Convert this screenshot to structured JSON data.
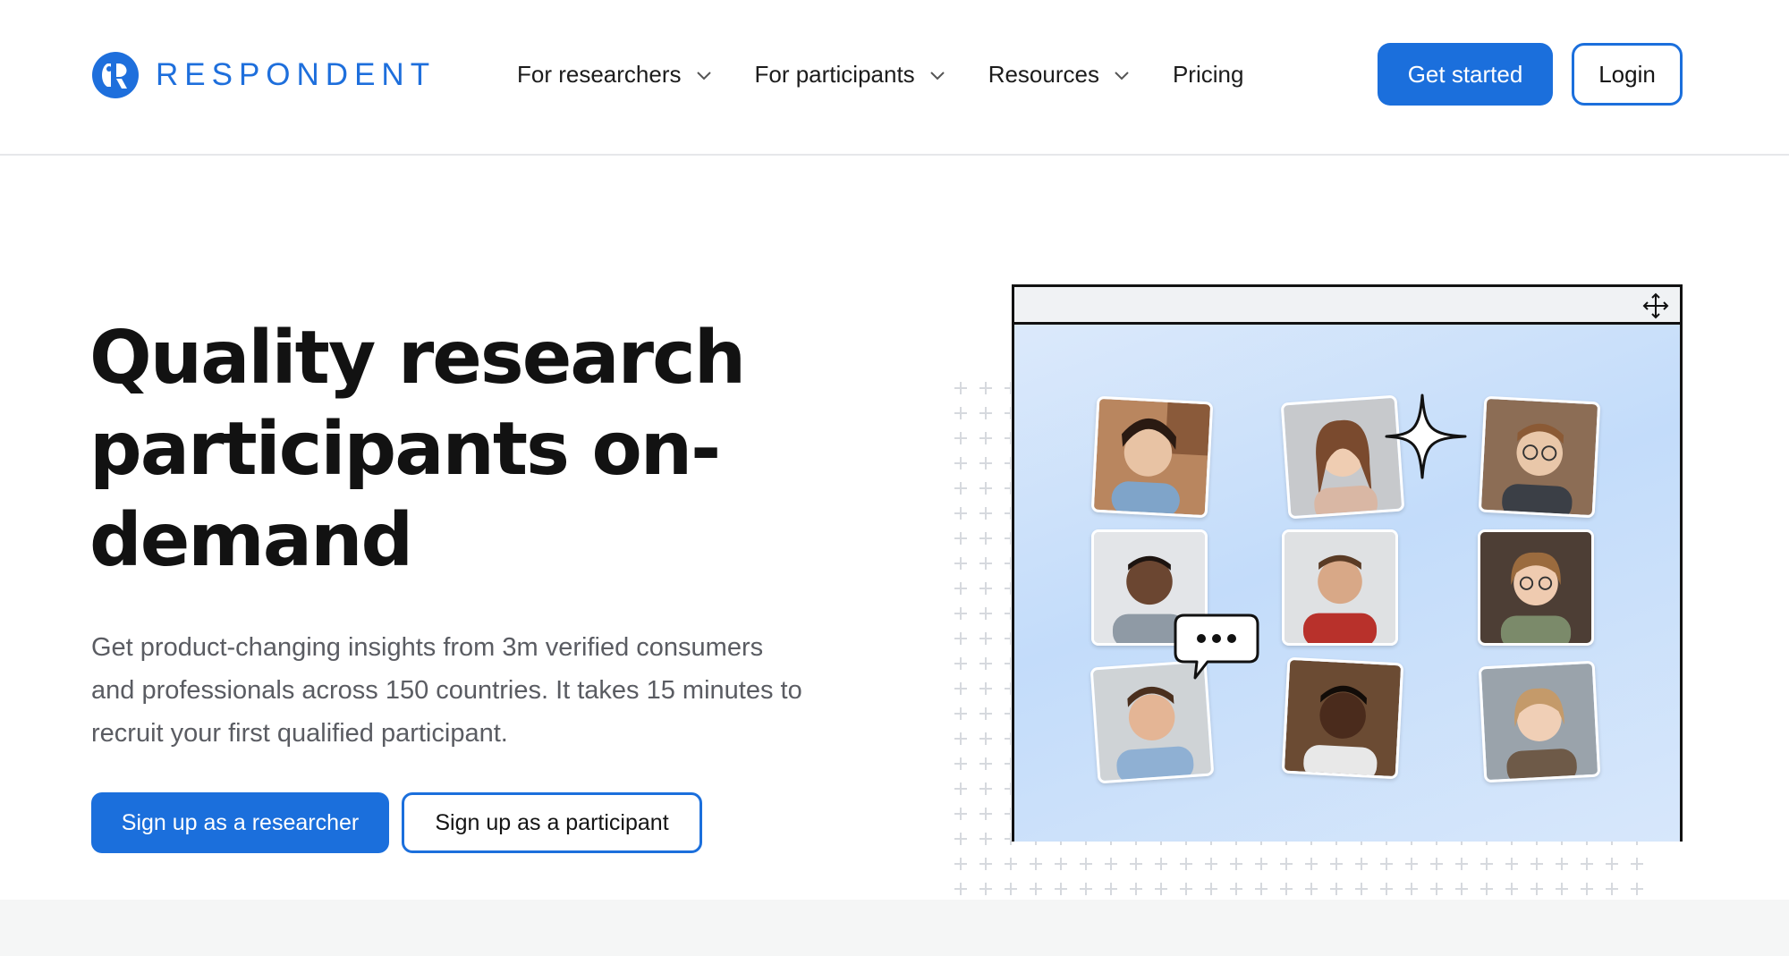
{
  "brand": {
    "name": "RESPONDENT",
    "accent": "#1b6fdc"
  },
  "nav": {
    "items": [
      {
        "label": "For researchers",
        "has_dropdown": true
      },
      {
        "label": "For participants",
        "has_dropdown": true
      },
      {
        "label": "Resources",
        "has_dropdown": true
      },
      {
        "label": "Pricing",
        "has_dropdown": false
      }
    ],
    "get_started": "Get started",
    "login": "Login"
  },
  "hero": {
    "title": "Quality research participants on-demand",
    "subtitle": "Get product-changing insights from 3m verified consumers and professionals across 150 countries. It takes 15 minutes to recruit your first qualified participant.",
    "cta_researcher": "Sign up as a researcher",
    "cta_participant": "Sign up as a participant"
  },
  "illustration": {
    "icons": [
      "move-icon",
      "sparkle-icon",
      "chat-bubble-icon"
    ],
    "participant_photos": 9
  }
}
